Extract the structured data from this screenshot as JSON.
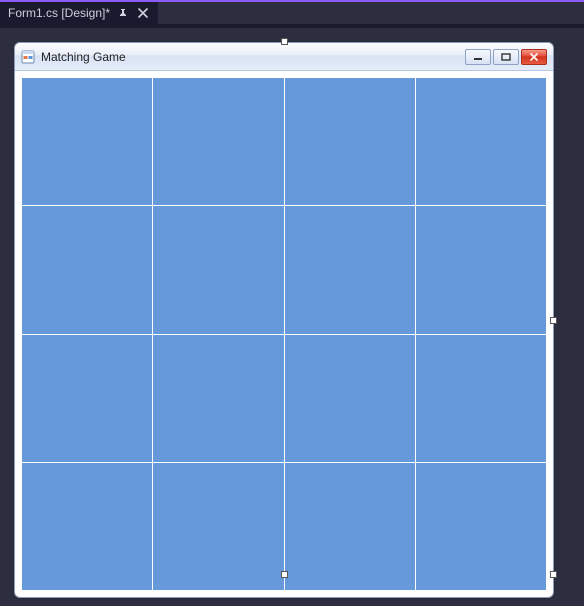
{
  "tab": {
    "label": "Form1.cs [Design]*"
  },
  "form": {
    "title": "Matching Game"
  },
  "grid": {
    "rows": 4,
    "cols": 4
  },
  "colors": {
    "cell_bg": "#6699db",
    "ide_bg": "#2d2d40",
    "accent": "#8b5cf6"
  }
}
